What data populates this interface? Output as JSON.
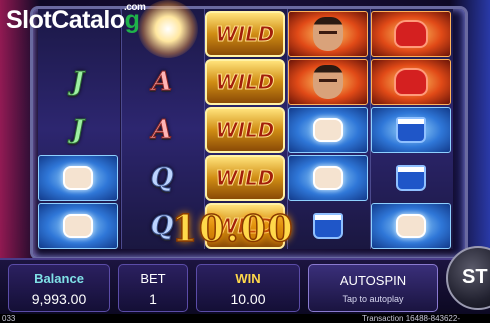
{
  "logo": {
    "part1": "Slot",
    "part2": "Catalo",
    "part3": "g",
    "suffix": ".com"
  },
  "reels": [
    [
      "",
      "J",
      "J",
      "fist",
      "fist"
    ],
    [
      "",
      "A",
      "A",
      "Q",
      "Q"
    ],
    [
      "WILD",
      "WILD",
      "WILD",
      "WILD",
      "WILD"
    ],
    [
      "fighter",
      "fighter",
      "fist",
      "fist",
      "shorts"
    ],
    [
      "glove",
      "glove",
      "shorts",
      "shorts",
      "fist"
    ]
  ],
  "win_display": "10.00",
  "panels": {
    "balance": {
      "label": "Balance",
      "value": "9,993.00"
    },
    "bet": {
      "label": "BET",
      "value": "1"
    },
    "win": {
      "label": "WIN",
      "value": "10.00"
    }
  },
  "autospin": {
    "label": "AUTOSPIN",
    "hint": "Tap to autoplay"
  },
  "start_button": {
    "label": "ST"
  },
  "footer": {
    "left": "033",
    "right": "Transaction 16488-843622-"
  },
  "colors": {
    "accent_win": "#ffd84a",
    "label_cyan": "#7fe0e6",
    "frame": "#6a6aa0"
  }
}
